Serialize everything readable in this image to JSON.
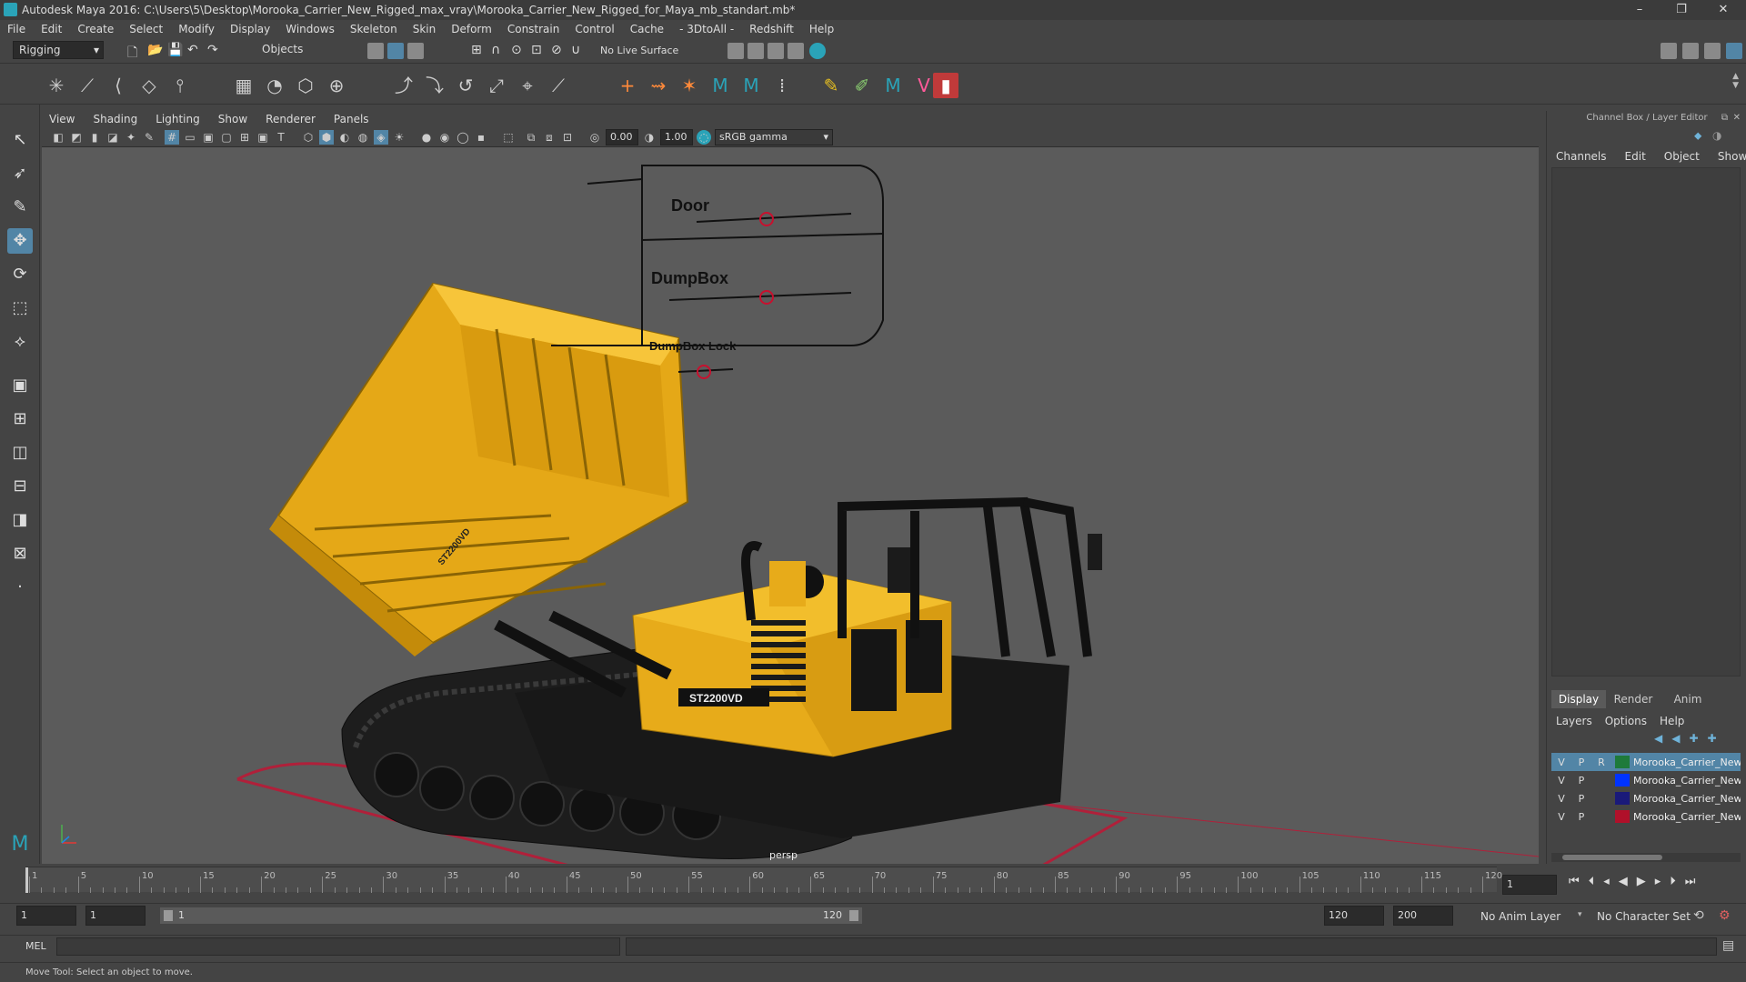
{
  "window": {
    "title": "Autodesk Maya 2016: C:\\Users\\5\\Desktop\\Morooka_Carrier_New_Rigged_max_vray\\Morooka_Carrier_New_Rigged_for_Maya_mb_standart.mb*",
    "minimize": "–",
    "maximize": "❐",
    "close": "✕"
  },
  "menubar": [
    "File",
    "Edit",
    "Create",
    "Select",
    "Modify",
    "Display",
    "Windows",
    "Skeleton",
    "Skin",
    "Deform",
    "Constrain",
    "Control",
    "Cache",
    "- 3DtoAll -",
    "Redshift",
    "Help"
  ],
  "statusline": {
    "menuset": "Rigging",
    "selection_mode": "Objects",
    "live_surface": "No Live Surface"
  },
  "panel": {
    "menus": [
      "View",
      "Shading",
      "Lighting",
      "Show",
      "Renderer",
      "Panels"
    ],
    "exposure": "0.00",
    "gamma": "1.00",
    "color_space": "sRGB gamma",
    "camera_label": "persp"
  },
  "rig_panel": {
    "labels": [
      "Door",
      "DumpBox",
      "DumpBox Lock"
    ]
  },
  "model": {
    "side_text": "ST2200VD",
    "boom_text": "ST2200VD"
  },
  "channel_box": {
    "title": "Channel Box / Layer Editor",
    "menus": [
      "Channels",
      "Edit",
      "Object",
      "Show"
    ],
    "tabs": [
      "Display",
      "Render",
      "Anim"
    ],
    "layer_menus": [
      "Layers",
      "Options",
      "Help"
    ],
    "layers": [
      {
        "v": "V",
        "p": "P",
        "r": "R",
        "name": "Morooka_Carrier_New",
        "color": "#1e7a3a",
        "selected": true
      },
      {
        "v": "V",
        "p": "P",
        "r": "",
        "name": "Morooka_Carrier_New",
        "color": "#0033ff",
        "selected": false
      },
      {
        "v": "V",
        "p": "P",
        "r": "",
        "name": "Morooka_Carrier_New",
        "color": "#1a1a7a",
        "selected": false
      },
      {
        "v": "V",
        "p": "P",
        "r": "",
        "name": "Morooka_Carrier_New",
        "color": "#b0102a",
        "selected": false
      }
    ]
  },
  "timeline": {
    "ticks": [
      "1",
      "5",
      "10",
      "15",
      "20",
      "25",
      "30",
      "35",
      "40",
      "45",
      "50",
      "55",
      "60",
      "65",
      "70",
      "75",
      "80",
      "85",
      "90",
      "95",
      "100",
      "105",
      "110",
      "115",
      "120"
    ],
    "current_frame": "1"
  },
  "range": {
    "start": "1",
    "playback_start": "1",
    "slider_start": "1",
    "slider_end": "120",
    "playback_end": "120",
    "end": "200",
    "anim_layer": "No Anim Layer",
    "character_set": "No Character Set"
  },
  "cmdline": {
    "label": "MEL"
  },
  "helpline": {
    "text": "Move Tool: Select an object to move."
  }
}
